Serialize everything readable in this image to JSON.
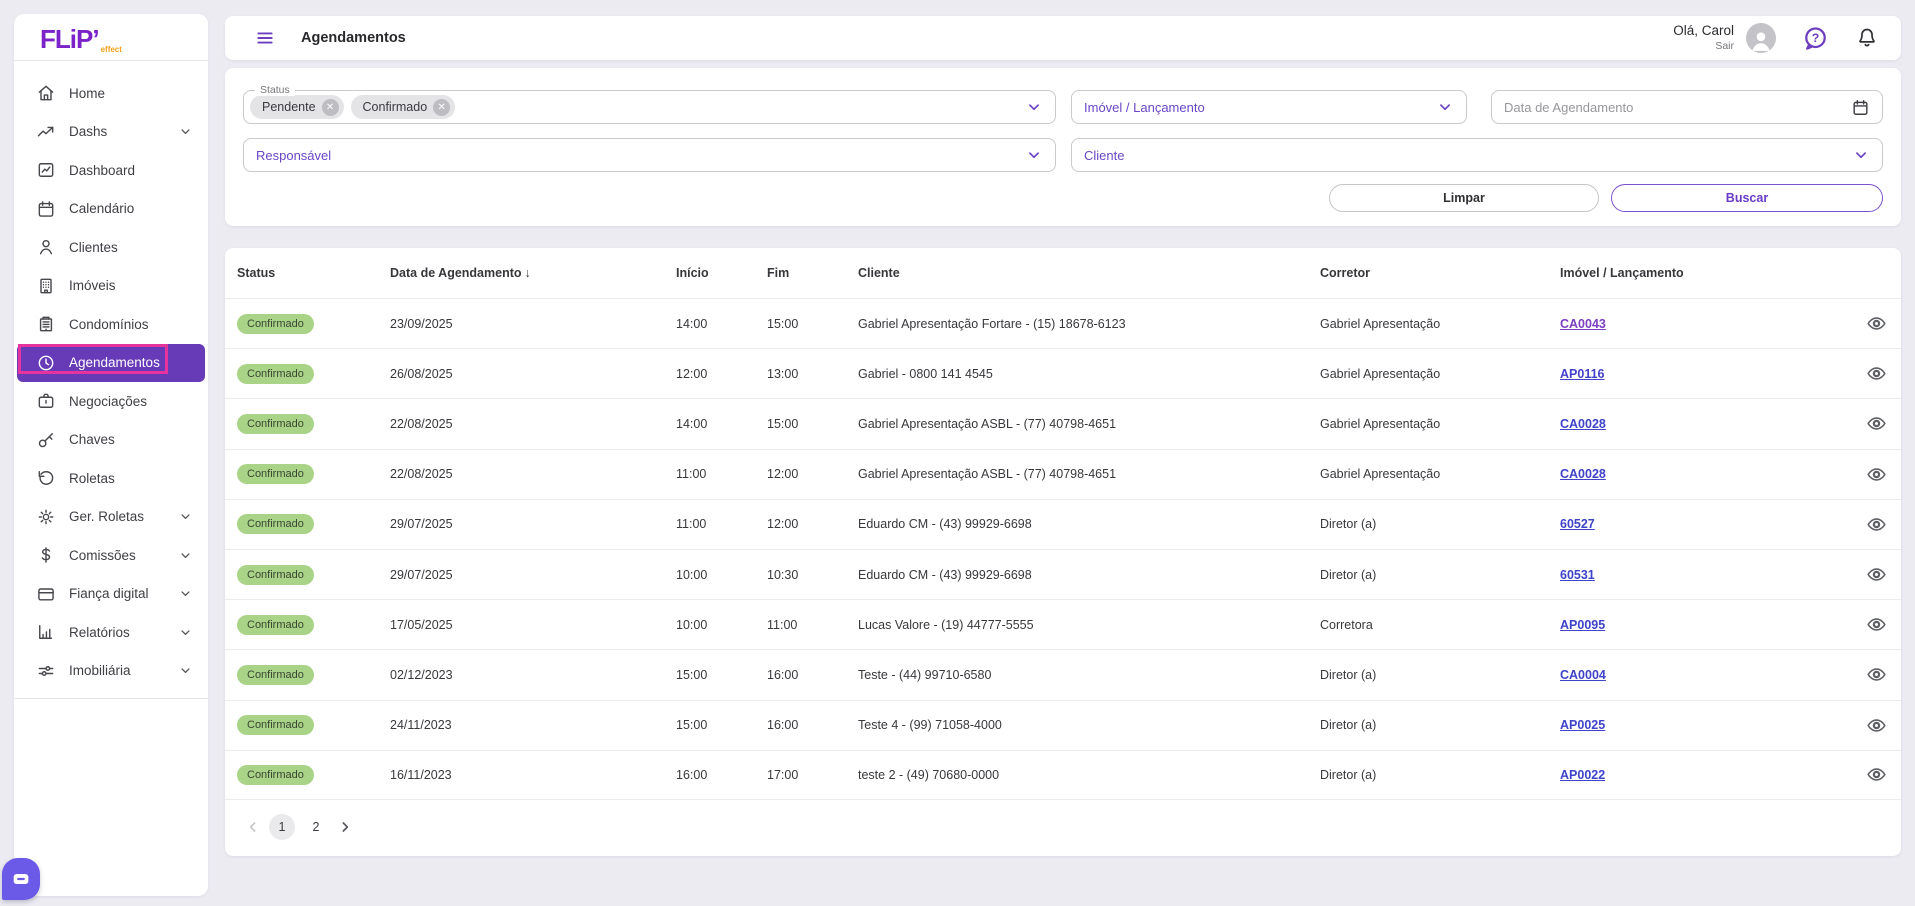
{
  "brand": {
    "name": "FLiP",
    "suffix": "effect"
  },
  "header": {
    "title": "Agendamentos",
    "greeting": "Olá, Carol",
    "logout_label": "Sair"
  },
  "sidebar": {
    "items": [
      {
        "label": "Home",
        "icon": "home",
        "expandable": false,
        "selected": false
      },
      {
        "label": "Dashs",
        "icon": "trending",
        "expandable": true,
        "selected": false
      },
      {
        "label": "Dashboard",
        "icon": "chart",
        "expandable": false,
        "selected": false
      },
      {
        "label": "Calendário",
        "icon": "calendar",
        "expandable": false,
        "selected": false
      },
      {
        "label": "Clientes",
        "icon": "person",
        "expandable": false,
        "selected": false
      },
      {
        "label": "Imóveis",
        "icon": "building",
        "expandable": false,
        "selected": false
      },
      {
        "label": "Condomínios",
        "icon": "condo",
        "expandable": false,
        "selected": false
      },
      {
        "label": "Agendamentos",
        "icon": "clock",
        "expandable": false,
        "selected": true
      },
      {
        "label": "Negociações",
        "icon": "briefcase",
        "expandable": false,
        "selected": false
      },
      {
        "label": "Chaves",
        "icon": "key",
        "expandable": false,
        "selected": false
      },
      {
        "label": "Roletas",
        "icon": "rotate",
        "expandable": false,
        "selected": false
      },
      {
        "label": "Ger. Roletas",
        "icon": "gear",
        "expandable": true,
        "selected": false
      },
      {
        "label": "Comissões",
        "icon": "dollar",
        "expandable": true,
        "selected": false
      },
      {
        "label": "Fiança digital",
        "icon": "card",
        "expandable": true,
        "selected": false
      },
      {
        "label": "Relatórios",
        "icon": "barchart",
        "expandable": true,
        "selected": false
      },
      {
        "label": "Imobiliária",
        "icon": "sliders",
        "expandable": true,
        "selected": false
      }
    ]
  },
  "filters": {
    "status_label": "Status",
    "status_chips": [
      {
        "label": "Pendente"
      },
      {
        "label": "Confirmado"
      }
    ],
    "imovel_placeholder": "Imóvel / Lançamento",
    "date_placeholder": "Data de Agendamento",
    "responsavel_placeholder": "Responsável",
    "cliente_placeholder": "Cliente",
    "clear_label": "Limpar",
    "search_label": "Buscar"
  },
  "table": {
    "columns": {
      "status": "Status",
      "date": "Data de Agendamento",
      "start": "Início",
      "end": "Fim",
      "client": "Cliente",
      "broker": "Corretor",
      "property": "Imóvel / Lançamento"
    },
    "sort_indicator": "↓",
    "rows": [
      {
        "status": "Confirmado",
        "date": "23/09/2025",
        "start": "14:00",
        "end": "15:00",
        "client": "Gabriel Apresentação Fortare - (15) 18678-6123",
        "broker": "Gabriel Apresentação",
        "property": "CA0043",
        "property_color": "#7B3FC0"
      },
      {
        "status": "Confirmado",
        "date": "26/08/2025",
        "start": "12:00",
        "end": "13:00",
        "client": "Gabriel - 0800 141 4545",
        "broker": "Gabriel Apresentação",
        "property": "AP0116",
        "property_color": "#4442CC"
      },
      {
        "status": "Confirmado",
        "date": "22/08/2025",
        "start": "14:00",
        "end": "15:00",
        "client": "Gabriel Apresentação ASBL - (77) 40798-4651",
        "broker": "Gabriel Apresentação",
        "property": "CA0028",
        "property_color": "#3E43C9"
      },
      {
        "status": "Confirmado",
        "date": "22/08/2025",
        "start": "11:00",
        "end": "12:00",
        "client": "Gabriel Apresentação ASBL - (77) 40798-4651",
        "broker": "Gabriel Apresentação",
        "property": "CA0028",
        "property_color": "#3E43C9"
      },
      {
        "status": "Confirmado",
        "date": "29/07/2025",
        "start": "11:00",
        "end": "12:00",
        "client": "Eduardo CM - (43) 99929-6698",
        "broker": "Diretor (a)",
        "property": "60527",
        "property_color": "#3E43C9"
      },
      {
        "status": "Confirmado",
        "date": "29/07/2025",
        "start": "10:00",
        "end": "10:30",
        "client": "Eduardo CM - (43) 99929-6698",
        "broker": "Diretor (a)",
        "property": "60531",
        "property_color": "#3E43C9"
      },
      {
        "status": "Confirmado",
        "date": "17/05/2025",
        "start": "10:00",
        "end": "11:00",
        "client": "Lucas Valore - (19) 44777-5555",
        "broker": "Corretora",
        "property": "AP0095",
        "property_color": "#3E43C9"
      },
      {
        "status": "Confirmado",
        "date": "02/12/2023",
        "start": "15:00",
        "end": "16:00",
        "client": "Teste - (44) 99710-6580",
        "broker": "Diretor (a)",
        "property": "CA0004",
        "property_color": "#3E43C9"
      },
      {
        "status": "Confirmado",
        "date": "24/11/2023",
        "start": "15:00",
        "end": "16:00",
        "client": "Teste 4 - (99) 71058-4000",
        "broker": "Diretor (a)",
        "property": "AP0025",
        "property_color": "#3E43C9"
      },
      {
        "status": "Confirmado",
        "date": "16/11/2023",
        "start": "16:00",
        "end": "17:00",
        "client": "teste 2 - (49) 70680-0000",
        "broker": "Diretor (a)",
        "property": "AP0022",
        "property_color": "#3E43C9"
      }
    ]
  },
  "pagination": {
    "pages": [
      "1",
      "2"
    ],
    "current_page": "1"
  },
  "colors": {
    "primary_purple": "#673AB7",
    "logo_purple": "#7B22C9",
    "logo_orange": "#F5A21B",
    "annotation_magenta": "#E6349F",
    "badge_green": "#A9D487",
    "link_blue": "#3E43C9",
    "link_purple": "#7B3FC0",
    "fab_purple": "#6B5AE8",
    "page_background": "#ECEBF2"
  }
}
